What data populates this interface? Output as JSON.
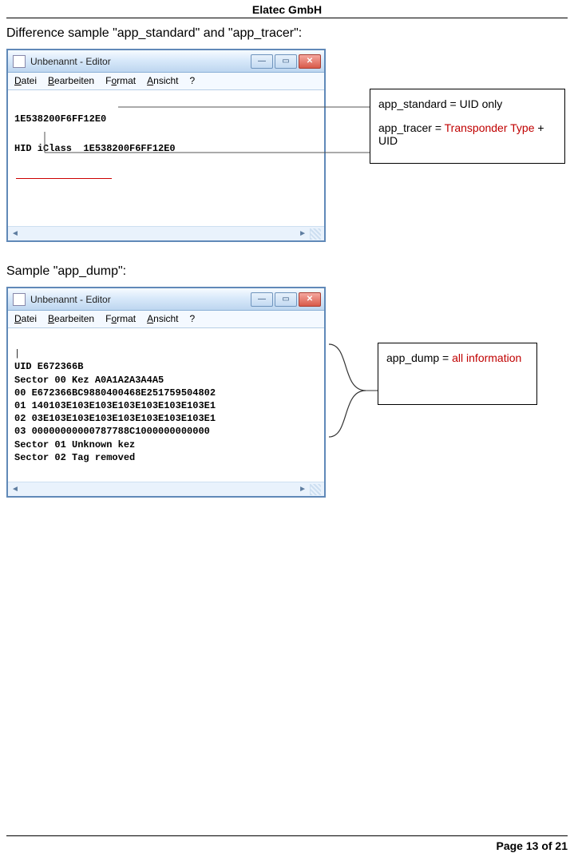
{
  "header": {
    "company": "Elatec GmbH"
  },
  "section1": {
    "heading": "Difference sample \"app_standard\" and \"app_tracer\":",
    "notepad": {
      "title": "Unbenannt - Editor",
      "menu": {
        "file": "Datei",
        "edit": "Bearbeiten",
        "format": "Format",
        "view": "Ansicht",
        "help": "?"
      },
      "lines": [
        "1E538200F6FF12E0",
        "HID iClass  1E538200F6FF12E0"
      ]
    },
    "callout": {
      "l1a": "app_standard",
      "l1b": " = UID only",
      "l2a": "app_tracer",
      "l2b": " = ",
      "l2c": "Transponder Type",
      "l2d": " + UID"
    }
  },
  "section2": {
    "heading": "Sample \"app_dump\":",
    "notepad": {
      "title": "Unbenannt - Editor",
      "menu": {
        "file": "Datei",
        "edit": "Bearbeiten",
        "format": "Format",
        "view": "Ansicht",
        "help": "?"
      },
      "lines": [
        "|",
        "UID E672366B",
        "Sector 00 Kez A0A1A2A3A4A5",
        "00 E672366BC9880400468E251759504802",
        "01 140103E103E103E103E103E103E103E1",
        "02 03E103E103E103E103E103E103E103E1",
        "03 00000000000787788C1000000000000",
        "Sector 01 Unknown kez",
        "Sector 02 Tag removed"
      ]
    },
    "callout": {
      "a": "app_dump",
      "b": " = ",
      "c": "all information"
    }
  },
  "footer": {
    "page": "Page 13 of 21"
  }
}
